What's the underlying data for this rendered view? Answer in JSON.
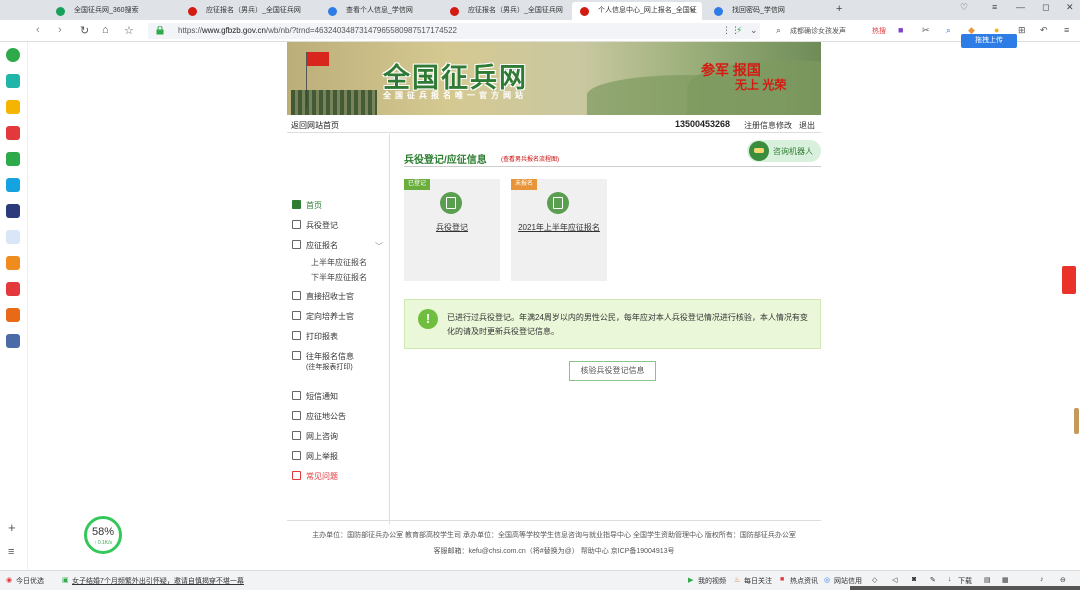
{
  "tabs": [
    {
      "label": "全国征兵网_360搜索",
      "color": "#19a05a"
    },
    {
      "label": "应征报名（男兵）_全国征兵网",
      "color": "#d41b12"
    },
    {
      "label": "查看个人信息_学信网",
      "color": "#2e7ce6"
    },
    {
      "label": "应征报名（男兵）_全国征兵网",
      "color": "#d41b12"
    },
    {
      "label": "个人信息中心_网上报名_全国征",
      "color": "#d41b12"
    },
    {
      "label": "找回密码_学信网",
      "color": "#2e7ce6"
    }
  ],
  "address": {
    "prefix": "https://",
    "host": "www.gfbzb.gov.cn",
    "path": "/wb/nb/?trnd=46324034873147965580987517174522"
  },
  "search": {
    "query": "成都确诊女孩发声",
    "hot": "热搜"
  },
  "upload_tip": "拖拽上传",
  "site": {
    "title": "全国征兵网",
    "subtitle": "全国征兵报名唯一官方网站",
    "slogan1": "参军 报国",
    "slogan2": "无上 光荣"
  },
  "topline": {
    "back_home": "返回网站首页",
    "phone": "13500453268",
    "edit_info": "注册信息修改",
    "logout": "退出"
  },
  "menu": {
    "home": "首页",
    "register": "兵役登记",
    "apply": "应征报名",
    "apply_sub1": "上半年应征报名",
    "apply_sub2": "下半年应征报名",
    "direct": "直接招收士官",
    "directed": "定向培养士官",
    "print": "打印报表",
    "history": "往年报名信息",
    "history_sub": "(往年报表打印)",
    "sms": "短信通知",
    "notice": "应征地公告",
    "consult": "网上咨询",
    "report": "网上举报",
    "faq": "常见问题"
  },
  "content": {
    "section_title": "兵役登记/应征信息",
    "section_link": "(查看男兵报名流程图)",
    "robot": "咨询机器人",
    "card1": {
      "tag": "已登记",
      "label": "兵役登记",
      "tag_color": "#6aaf3d"
    },
    "card2": {
      "tag": "未报名",
      "label": "2021年上半年应征报名",
      "tag_color": "#e8953a"
    },
    "notice_icon": "!",
    "notice_text": "已进行过兵役登记。年满24周岁以内的男性公民，每年应对本人兵役登记情况进行核验，本人情况有变化的请及时更新兵役登记信息。",
    "verify_button": "核验兵役登记信息"
  },
  "footer": {
    "line1": "主办单位：国防部征兵办公室    教育部高校学生司    承办单位：全国高等学校学生信息咨询与就业指导中心    全国学生资助管理中心    版权所有：国防部征兵办公室",
    "line2": "客服邮箱：kefu@chsi.com.cn（将#替换为@）    帮助中心    京ICP备19004913号"
  },
  "speed": {
    "percent": "58%",
    "rate": "↑ 0.1K/s"
  },
  "status": {
    "today": "今日优选",
    "news": "女子结婚7个月频繁外出引怀疑，邀请自慎揭穿不堪一幕",
    "my_video": "我的视频",
    "daily": "每日关注",
    "hot_news": "热点资讯",
    "credit": "网站信用",
    "download": "下载"
  }
}
